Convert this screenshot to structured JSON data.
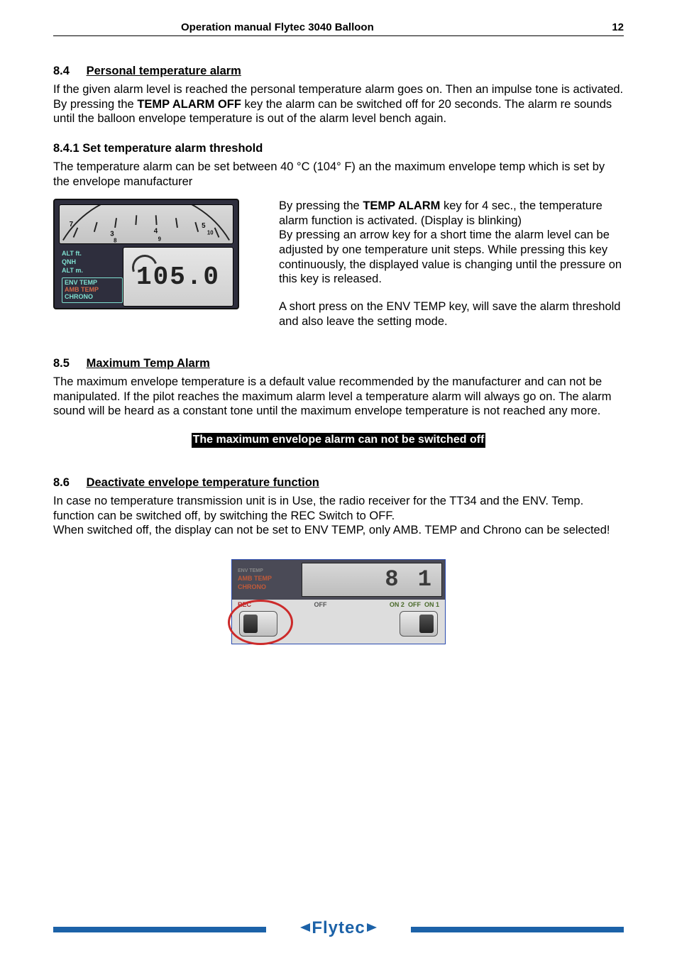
{
  "header": {
    "title": "Operation manual Flytec  3040 Balloon",
    "page": "12"
  },
  "s84": {
    "num": "8.4",
    "title": "Personal temperature alarm",
    "p1a": "If the given alarm level is reached the personal temperature alarm goes on. Then an impulse tone is activated. By pressing the ",
    "p1bold": "TEMP ALARM OFF",
    "p1b": " key the alarm can be switched off for 20 seconds. The alarm re sounds until the balloon envelope temperature is out of the alarm level bench again."
  },
  "s841": {
    "heading": "8.4.1   Set temperature alarm threshold",
    "p1": "The temperature alarm can be set between 40 °C (104° F) an the maximum envelope temp which is set by the envelope manufacturer",
    "r1a": "By pressing the ",
    "r1bold": "TEMP ALARM",
    "r1b": " key for 4 sec., the temperature alarm function is activated. (Display is blinking)",
    "r2": "By pressing an arrow key for a short time the alarm level can be adjusted by one temperature unit steps. While pressing this key continuously, the displayed value is changing until the pressure on this key is released.",
    "r3": "A short press on the ENV TEMP key, will save the alarm threshold and also leave the setting mode."
  },
  "deviceA": {
    "alt_ft": "ALT ft.",
    "qnh": "QNH",
    "alt_m": "ALT m.",
    "env": "ENV TEMP",
    "amb": "AMB TEMP",
    "chrono": "CHRONO",
    "value": "105.0",
    "ticks": {
      "n3": "3",
      "n4": "4",
      "n7": "7",
      "n8": "8",
      "n9": "9",
      "n5": "5",
      "n10": "10"
    }
  },
  "s85": {
    "num": "8.5",
    "title": "Maximum Temp Alarm",
    "p1": "The maximum envelope temperature is a default value recommended by the manufacturer and can not be manipulated. If the pilot reaches the maximum alarm level a temperature alarm will always go on. The alarm sound will be heard as a constant tone until the maximum envelope temperature is not reached any more.",
    "highlight": "The maximum envelope alarm can not be switched off"
  },
  "s86": {
    "num": "8.6",
    "title": "Deactivate envelope temperature function",
    "p1": "In case no temperature transmission unit is in Use, the radio receiver for the TT34 and the ENV. Temp. function can be switched off, by switching the REC Switch to OFF.",
    "p2": "When switched off, the display can not be set to ENV TEMP, only AMB. TEMP and Chrono can be selected!"
  },
  "deviceB": {
    "env": "ENV TEMP",
    "amb": "AMB TEMP",
    "chrono": "CHRONO",
    "value": "8 1",
    "rec": "REC",
    "off": "OFF",
    "on2": "ON 2",
    "off2": "OFF",
    "on1": "ON 1"
  },
  "footer": {
    "brand": "Flytec"
  }
}
